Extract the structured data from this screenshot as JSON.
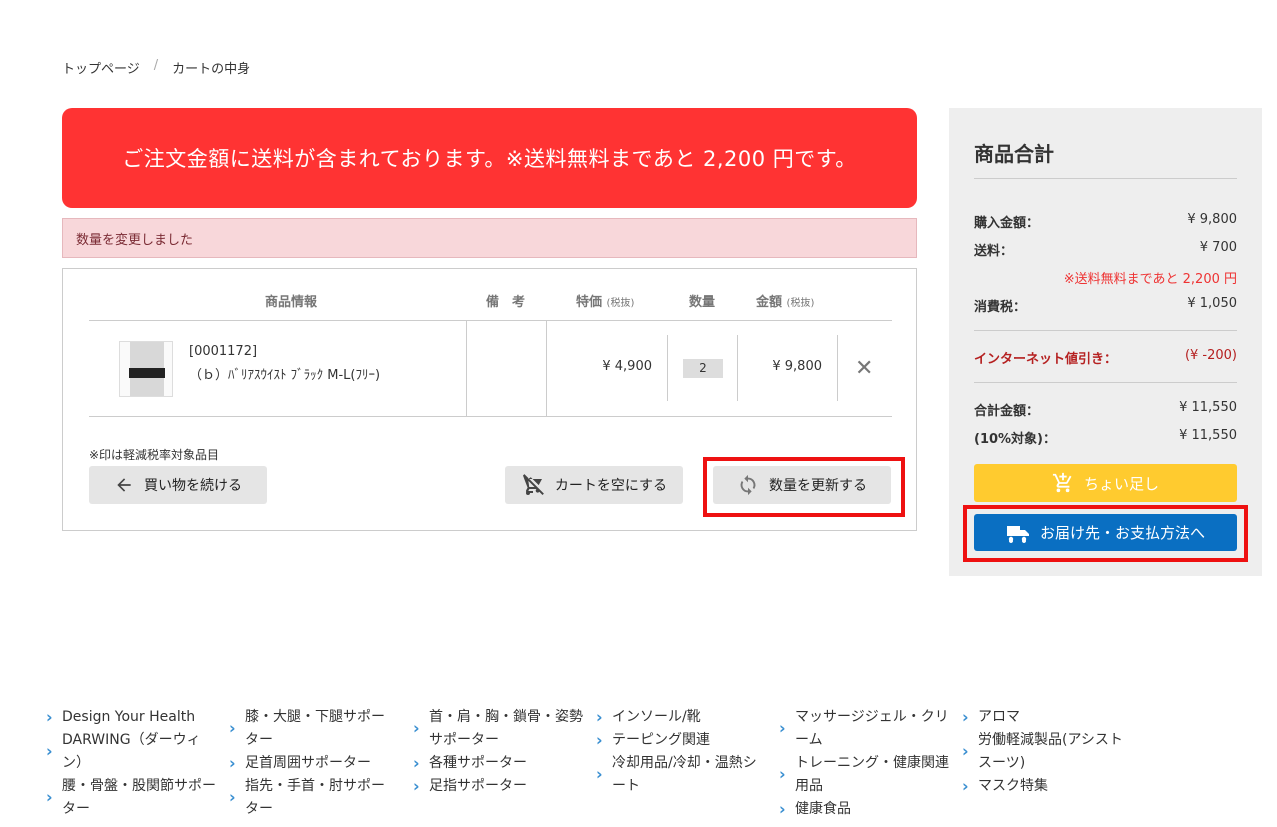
{
  "breadcrumb": {
    "home": "トップページ",
    "sep": "/",
    "current": "カートの中身"
  },
  "notice": "ご注文金額に送料が含まれております。※送料無料まであと 2,200 円です。",
  "alert": "数量を変更しました",
  "table": {
    "headers": {
      "product": "商品情報",
      "memo": "備　考",
      "price": "特価",
      "price_note": "(税抜)",
      "qty": "数量",
      "amount": "金額",
      "amount_note": "(税抜)"
    },
    "rows": [
      {
        "code": "[0001172]",
        "name": "（ｂ）ﾊﾞﾘｱｽｳｲｽﾄ ﾌﾞﾗｯｸ M-L(ﾌﾘｰ)",
        "price": "¥ 4,900",
        "qty": "2",
        "amount": "¥ 9,800"
      }
    ]
  },
  "reduced_note": "※印は軽減税率対象品目",
  "buttons": {
    "continue": "買い物を続ける",
    "empty": "カートを空にする",
    "update": "数量を更新する"
  },
  "summary": {
    "title": "商品合計",
    "purchase_label": "購入金額：",
    "purchase": "¥ 9,800",
    "shipping_label": "送料：",
    "shipping": "¥ 700",
    "free_note": "※送料無料まであと 2,200 円",
    "tax_label": "消費税：",
    "tax": "¥ 1,050",
    "discount_label": "インターネット値引き：",
    "discount": "(¥ -200)",
    "total_label": "合計金額：",
    "total": "¥ 11,550",
    "taxable_label": "(10%対象)：",
    "taxable": "¥ 11,550",
    "addon_button": "ちょい足し",
    "checkout_button": "お届け先・お支払方法へ"
  },
  "footer": {
    "col1": [
      "Design Your Health",
      "DARWING（ダーウィン）",
      "腰・骨盤・股関節サポーター"
    ],
    "col2": [
      "膝・大腿・下腿サポーター",
      "足首周囲サポーター",
      "指先・手首・肘サポーター"
    ],
    "col3": [
      "首・肩・胸・鎖骨・姿勢サポーター",
      "各種サポーター",
      "足指サポーター"
    ],
    "col4": [
      "インソール/靴",
      "テーピング関連",
      "冷却用品/冷却・温熱シート"
    ],
    "col5": [
      "マッサージジェル・クリーム",
      "トレーニング・健康関連用品",
      "健康食品"
    ],
    "col6": [
      "アロマ",
      "労働軽減製品(アシストスーツ)",
      "マスク特集"
    ]
  },
  "colors": {
    "notice_bg": "#ff3333",
    "checkout_bg": "#0a6fc2",
    "addon_bg": "#ffcb2f",
    "highlight": "#ee1111"
  }
}
